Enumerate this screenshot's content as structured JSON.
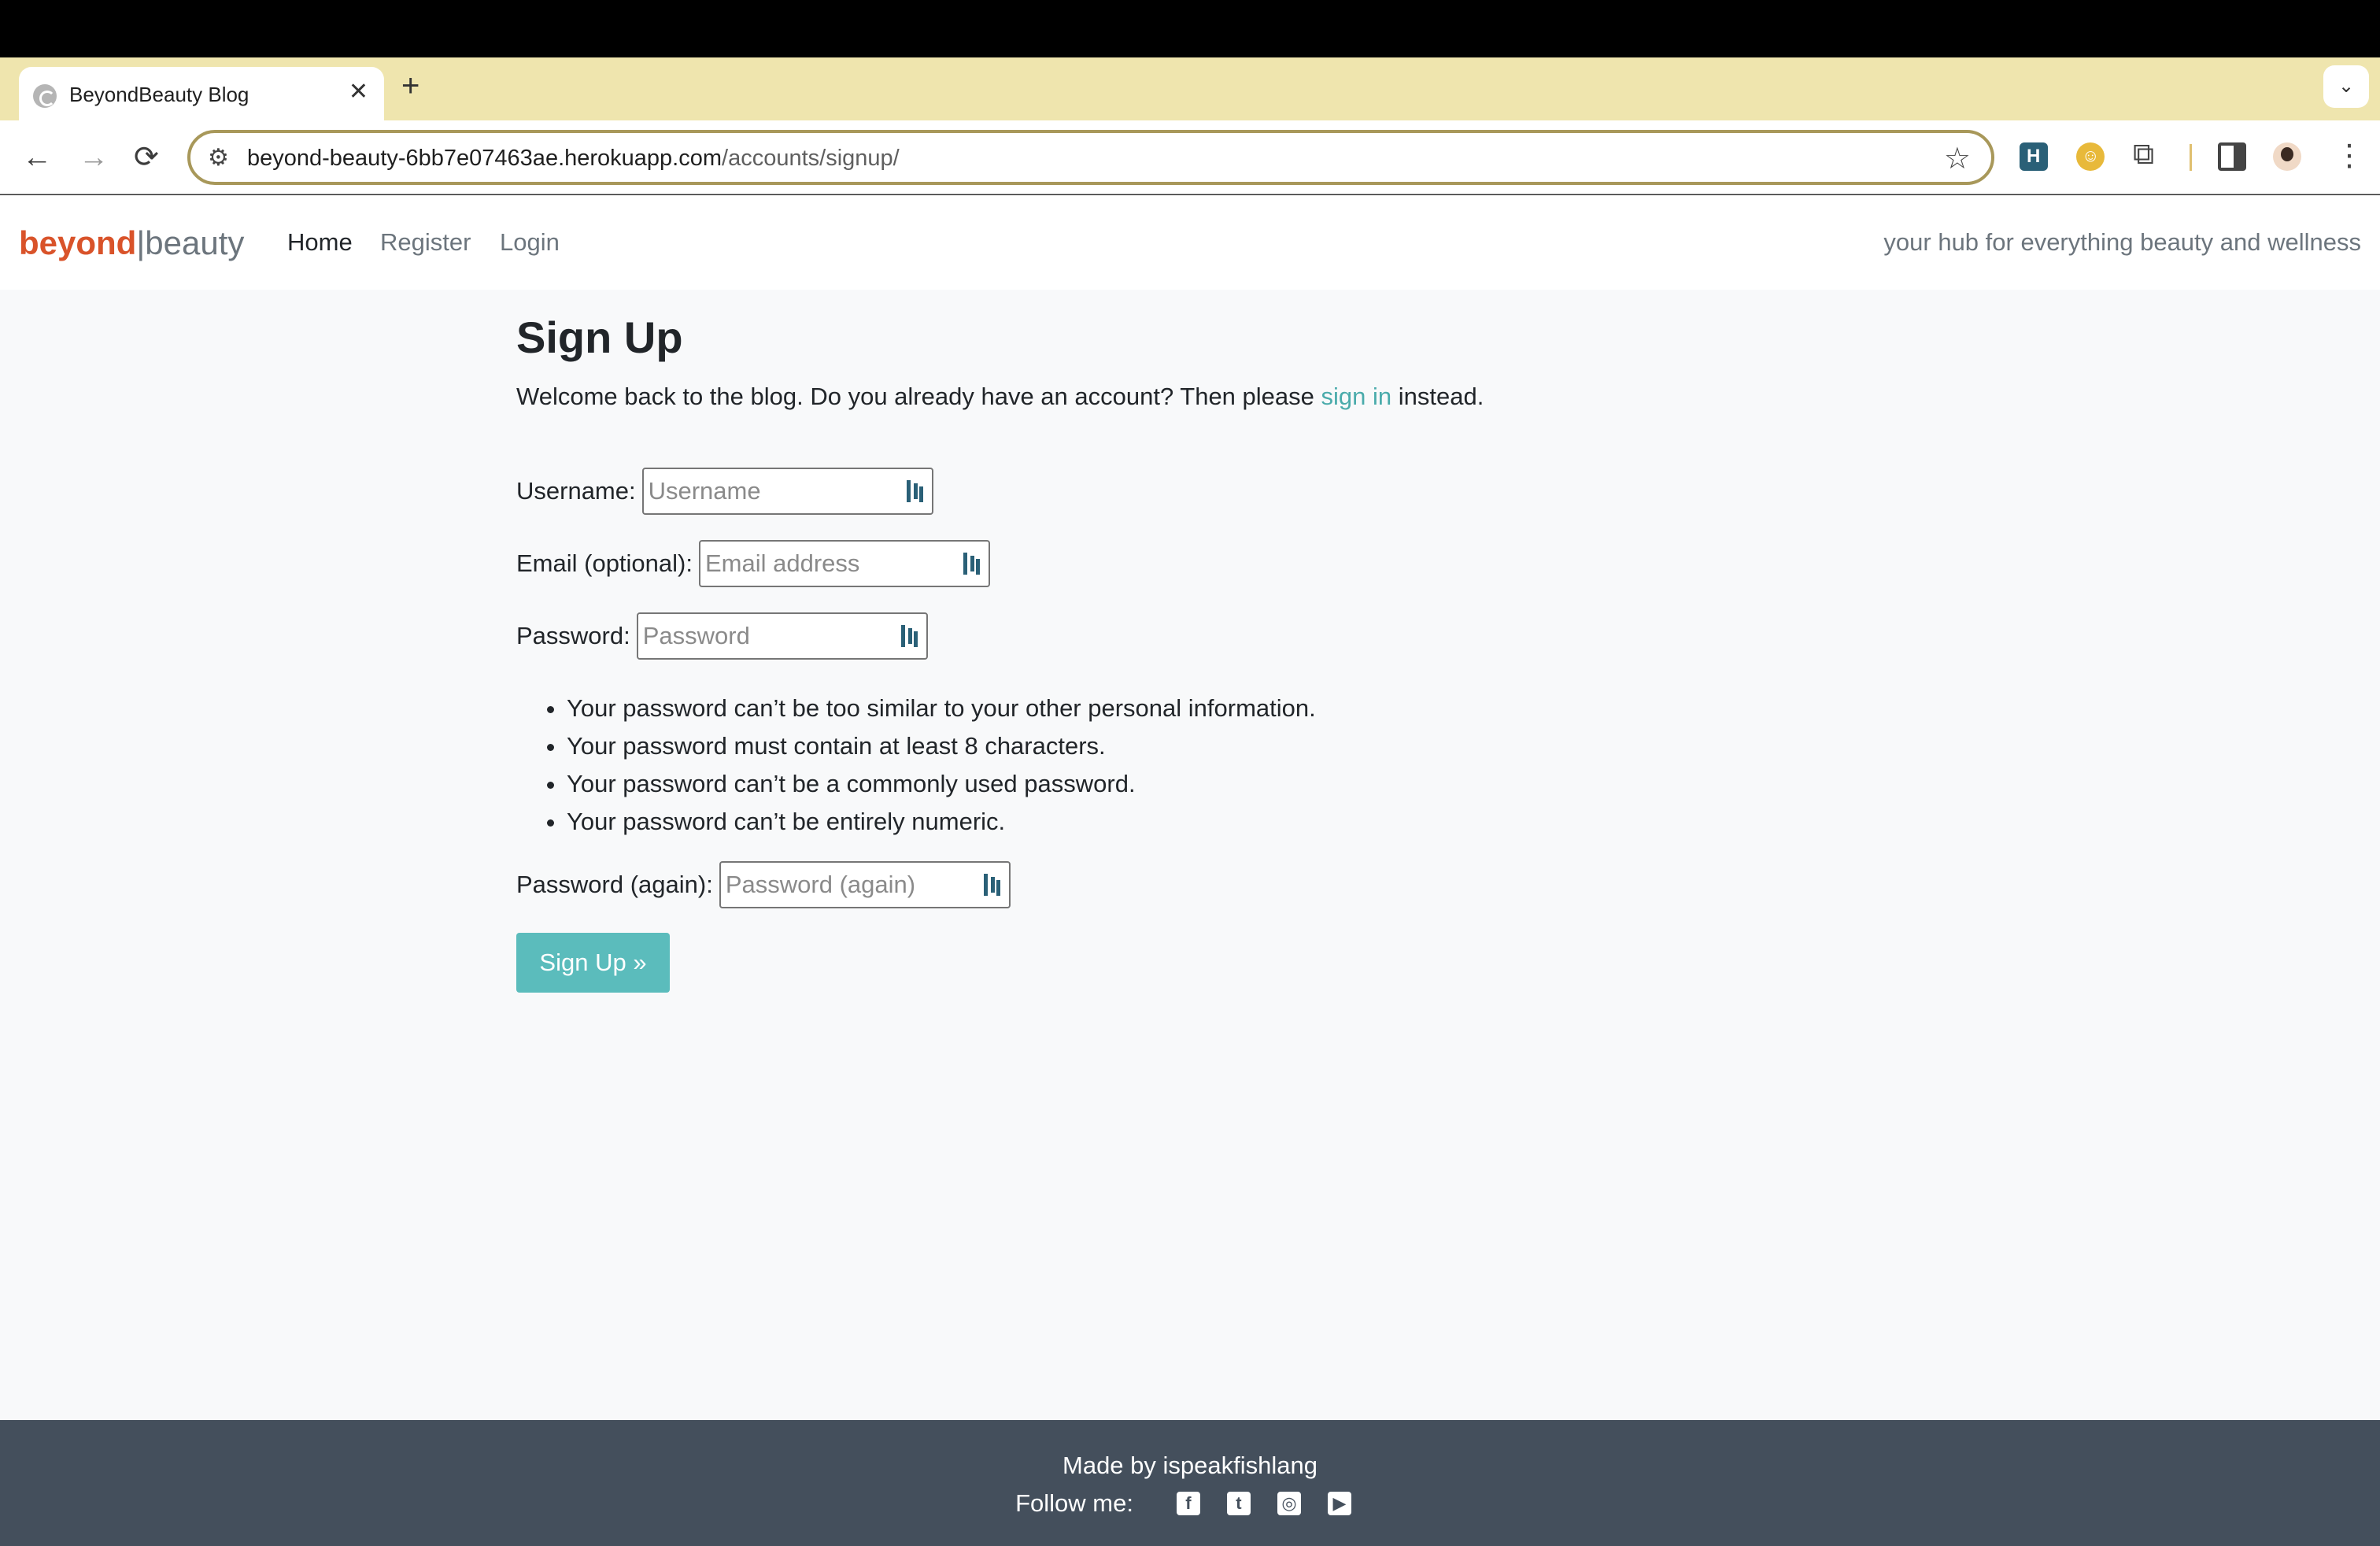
{
  "browser": {
    "tab_title": "BeyondBeauty Blog",
    "tab_close": "✕",
    "new_tab": "+",
    "tabs_dropdown": "⌄",
    "url_host": "beyond-beauty-6bb7e07463ae.herokuapp.com",
    "url_path": "/accounts/signup/",
    "back": "←",
    "forward": "→",
    "reload": "⟳",
    "star": "☆",
    "menu": "⋮",
    "site_info": "⚙",
    "extensions_icon": "⧉"
  },
  "site": {
    "brand_part1": "beyond",
    "brand_sep": "|",
    "brand_part2": "beauty",
    "nav": [
      {
        "label": "Home"
      },
      {
        "label": "Register"
      },
      {
        "label": "Login"
      }
    ],
    "tagline": "your hub for everything beauty and wellness"
  },
  "signup": {
    "title": "Sign Up",
    "intro_before": "Welcome back to the blog. Do you already have an account? Then please ",
    "intro_link": "sign in",
    "intro_after": " instead.",
    "fields": {
      "username": {
        "label": "Username:",
        "placeholder": "Username",
        "value": ""
      },
      "email": {
        "label": "Email (optional):",
        "placeholder": "Email address",
        "value": ""
      },
      "password": {
        "label": "Password:",
        "placeholder": "Password",
        "value": ""
      },
      "password2": {
        "label": "Password (again):",
        "placeholder": "Password (again)",
        "value": ""
      }
    },
    "rules": [
      "Your password can’t be too similar to your other personal information.",
      "Your password must contain at least 8 characters.",
      "Your password can’t be a commonly used password.",
      "Your password can’t be entirely numeric."
    ],
    "submit_label": "Sign Up »"
  },
  "footer": {
    "made_by": "Made by ispeakfishlang",
    "follow_label": "Follow me:",
    "social": [
      {
        "icon": "facebook-icon",
        "glyph": "f"
      },
      {
        "icon": "twitter-icon",
        "glyph": "t"
      },
      {
        "icon": "instagram-icon",
        "glyph": "◎"
      },
      {
        "icon": "youtube-icon",
        "glyph": "▶"
      }
    ]
  },
  "colors": {
    "brand_accent": "#d9532a",
    "link": "#4aabab",
    "button": "#5bbcbc",
    "footer_bg": "#444f5c",
    "tabstrip_bg": "#efe5ae"
  }
}
